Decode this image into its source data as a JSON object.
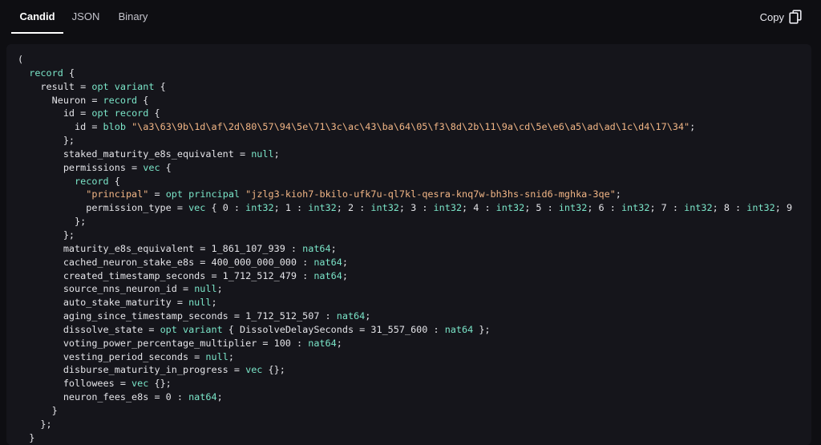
{
  "tabs": [
    {
      "label": "Candid",
      "active": true
    },
    {
      "label": "JSON",
      "active": false
    },
    {
      "label": "Binary",
      "active": false
    }
  ],
  "copy_label": "Copy",
  "colors": {
    "background": "#0e0e12",
    "panel": "#15151b",
    "keyword": "#7be6c9",
    "string": "#f1b585",
    "text": "#e4e4e8"
  },
  "code_lines": [
    [
      {
        "t": "("
      }
    ],
    [
      {
        "t": "  "
      },
      {
        "t": "record",
        "c": "kw"
      },
      {
        "t": " {"
      }
    ],
    [
      {
        "t": "    result = "
      },
      {
        "t": "opt",
        "c": "kw"
      },
      {
        "t": " "
      },
      {
        "t": "variant",
        "c": "kw"
      },
      {
        "t": " {"
      }
    ],
    [
      {
        "t": "      Neuron = "
      },
      {
        "t": "record",
        "c": "kw"
      },
      {
        "t": " {"
      }
    ],
    [
      {
        "t": "        id = "
      },
      {
        "t": "opt",
        "c": "kw"
      },
      {
        "t": " "
      },
      {
        "t": "record",
        "c": "kw"
      },
      {
        "t": " {"
      }
    ],
    [
      {
        "t": "          id = "
      },
      {
        "t": "blob",
        "c": "kw"
      },
      {
        "t": " "
      },
      {
        "t": "\"\\a3\\63\\9b\\1d\\af\\2d\\80\\57\\94\\5e\\71\\3c\\ac\\43\\ba\\64\\05\\f3\\8d\\2b\\11\\9a\\cd\\5e\\e6\\a5\\ad\\ad\\1c\\d4\\17\\34\"",
        "c": "str"
      },
      {
        "t": ";"
      }
    ],
    [
      {
        "t": "        };"
      }
    ],
    [
      {
        "t": "        staked_maturity_e8s_equivalent = "
      },
      {
        "t": "null",
        "c": "kw"
      },
      {
        "t": ";"
      }
    ],
    [
      {
        "t": "        permissions = "
      },
      {
        "t": "vec",
        "c": "kw"
      },
      {
        "t": " {"
      }
    ],
    [
      {
        "t": "          "
      },
      {
        "t": "record",
        "c": "kw"
      },
      {
        "t": " {"
      }
    ],
    [
      {
        "t": "            "
      },
      {
        "t": "\"principal\"",
        "c": "str"
      },
      {
        "t": " = "
      },
      {
        "t": "opt",
        "c": "kw"
      },
      {
        "t": " "
      },
      {
        "t": "principal",
        "c": "kw"
      },
      {
        "t": " "
      },
      {
        "t": "\"jzlg3-kioh7-bkilo-ufk7u-ql7kl-qesra-knq7w-bh3hs-snid6-mghka-3qe\"",
        "c": "str"
      },
      {
        "t": ";"
      }
    ],
    [
      {
        "t": "            permission_type = "
      },
      {
        "t": "vec",
        "c": "kw"
      },
      {
        "t": " { 0 : "
      },
      {
        "t": "int32",
        "c": "kw"
      },
      {
        "t": "; 1 : "
      },
      {
        "t": "int32",
        "c": "kw"
      },
      {
        "t": "; 2 : "
      },
      {
        "t": "int32",
        "c": "kw"
      },
      {
        "t": "; 3 : "
      },
      {
        "t": "int32",
        "c": "kw"
      },
      {
        "t": "; 4 : "
      },
      {
        "t": "int32",
        "c": "kw"
      },
      {
        "t": "; 5 : "
      },
      {
        "t": "int32",
        "c": "kw"
      },
      {
        "t": "; 6 : "
      },
      {
        "t": "int32",
        "c": "kw"
      },
      {
        "t": "; 7 : "
      },
      {
        "t": "int32",
        "c": "kw"
      },
      {
        "t": "; 8 : "
      },
      {
        "t": "int32",
        "c": "kw"
      },
      {
        "t": "; 9"
      }
    ],
    [
      {
        "t": "          };"
      }
    ],
    [
      {
        "t": "        };"
      }
    ],
    [
      {
        "t": "        maturity_e8s_equivalent = 1_861_107_939 : "
      },
      {
        "t": "nat64",
        "c": "kw"
      },
      {
        "t": ";"
      }
    ],
    [
      {
        "t": "        cached_neuron_stake_e8s = 400_000_000_000 : "
      },
      {
        "t": "nat64",
        "c": "kw"
      },
      {
        "t": ";"
      }
    ],
    [
      {
        "t": "        created_timestamp_seconds = 1_712_512_479 : "
      },
      {
        "t": "nat64",
        "c": "kw"
      },
      {
        "t": ";"
      }
    ],
    [
      {
        "t": "        source_nns_neuron_id = "
      },
      {
        "t": "null",
        "c": "kw"
      },
      {
        "t": ";"
      }
    ],
    [
      {
        "t": "        auto_stake_maturity = "
      },
      {
        "t": "null",
        "c": "kw"
      },
      {
        "t": ";"
      }
    ],
    [
      {
        "t": "        aging_since_timestamp_seconds = 1_712_512_507 : "
      },
      {
        "t": "nat64",
        "c": "kw"
      },
      {
        "t": ";"
      }
    ],
    [
      {
        "t": "        dissolve_state = "
      },
      {
        "t": "opt",
        "c": "kw"
      },
      {
        "t": " "
      },
      {
        "t": "variant",
        "c": "kw"
      },
      {
        "t": " { DissolveDelaySeconds = 31_557_600 : "
      },
      {
        "t": "nat64",
        "c": "kw"
      },
      {
        "t": " };"
      }
    ],
    [
      {
        "t": "        voting_power_percentage_multiplier = 100 : "
      },
      {
        "t": "nat64",
        "c": "kw"
      },
      {
        "t": ";"
      }
    ],
    [
      {
        "t": "        vesting_period_seconds = "
      },
      {
        "t": "null",
        "c": "kw"
      },
      {
        "t": ";"
      }
    ],
    [
      {
        "t": "        disburse_maturity_in_progress = "
      },
      {
        "t": "vec",
        "c": "kw"
      },
      {
        "t": " {};"
      }
    ],
    [
      {
        "t": "        followees = "
      },
      {
        "t": "vec",
        "c": "kw"
      },
      {
        "t": " {};"
      }
    ],
    [
      {
        "t": "        neuron_fees_e8s = 0 : "
      },
      {
        "t": "nat64",
        "c": "kw"
      },
      {
        "t": ";"
      }
    ],
    [
      {
        "t": "      }"
      }
    ],
    [
      {
        "t": "    };"
      }
    ],
    [
      {
        "t": "  }"
      }
    ]
  ]
}
